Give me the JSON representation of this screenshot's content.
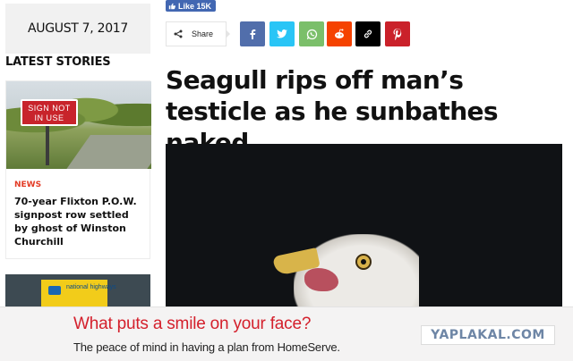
{
  "sidebar": {
    "date": "AUGUST 7, 2017",
    "latest_heading": "LATEST STORIES",
    "stories": [
      {
        "category": "NEWS",
        "title": "70-year Flixton P.O.W. signpost row settled by ghost of Winston Churchill",
        "thumb_sign_text": "SIGN NOT IN USE"
      },
      {
        "thumb_sign_text": "national highways"
      }
    ]
  },
  "social": {
    "like_label": "Like 15K",
    "share_label": "Share",
    "buttons": [
      {
        "name": "facebook",
        "icon": "f",
        "color": "#516eab"
      },
      {
        "name": "twitter",
        "icon": "twitter-bird",
        "color": "#29c5f6"
      },
      {
        "name": "whatsapp",
        "icon": "whatsapp",
        "color": "#7bbf6a"
      },
      {
        "name": "reddit",
        "icon": "reddit",
        "color": "#f54200"
      },
      {
        "name": "copy-link",
        "icon": "link",
        "color": "#000000"
      },
      {
        "name": "pinterest",
        "icon": "p",
        "color": "#ca212a"
      }
    ]
  },
  "article": {
    "headline": "Seagull rips off man’s testicle as he sunbathes naked"
  },
  "ad": {
    "headline": "What puts a smile on your face?",
    "subtext": "The peace of mind in having a plan from HomeServe."
  },
  "watermark": "YAPLAKAL.COM"
}
